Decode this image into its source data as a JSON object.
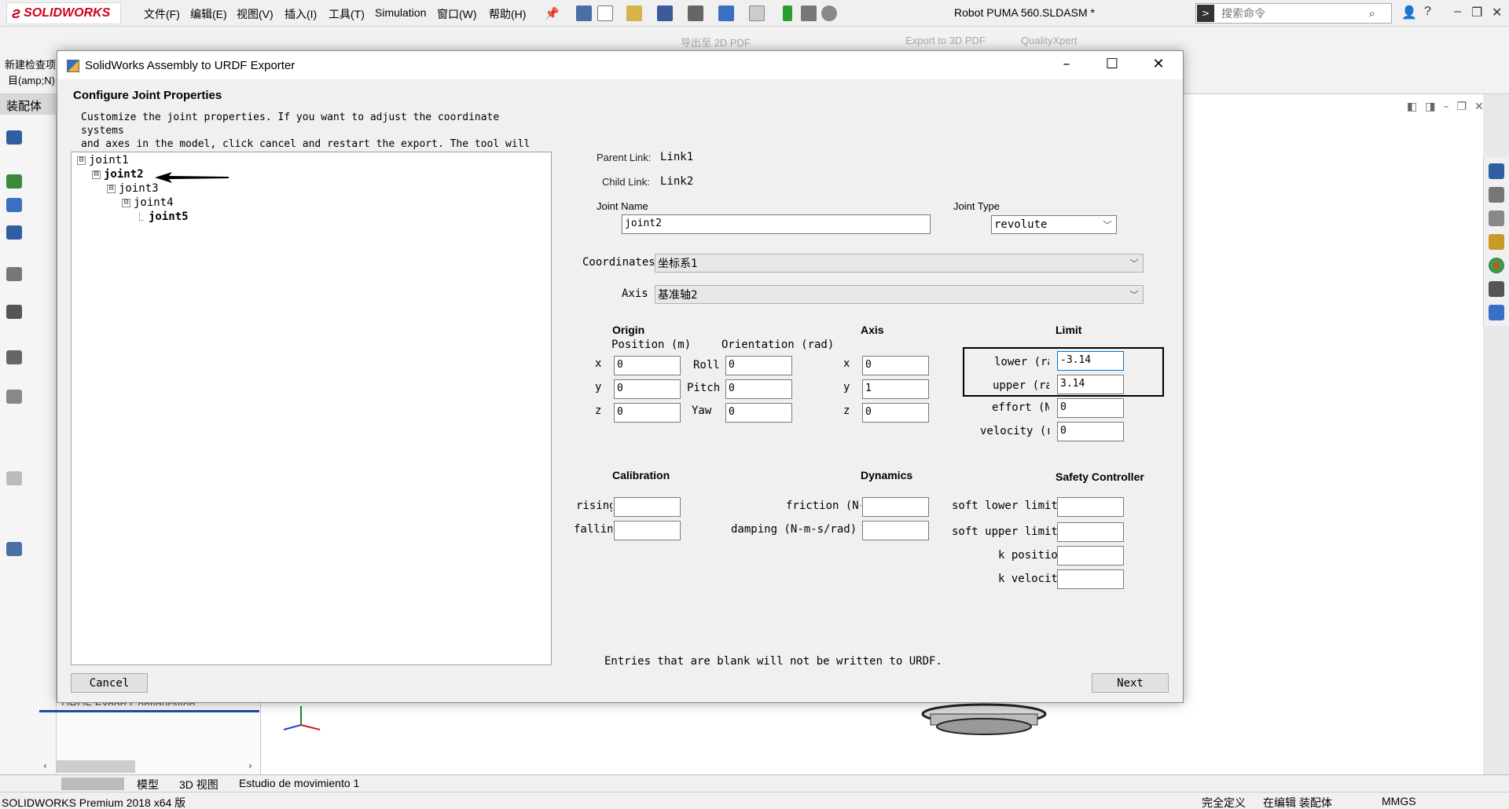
{
  "sw": {
    "logo_text": "SOLIDWORKS",
    "menu": [
      "文件(F)",
      "编辑(E)",
      "视图(V)",
      "插入(I)",
      "工具(T)",
      "Simulation",
      "窗口(W)",
      "帮助(H)"
    ],
    "document_title": "Robot PUMA 560.SLDASM *",
    "search_placeholder": "搜索命令",
    "ribbon_grey": [
      "导出至 2D PDF",
      "Export to 3D PDF",
      "QualityXpert"
    ],
    "left_labels": [
      "新建检查项",
      "目(amp;N)",
      "装配体"
    ],
    "bottom_tabs": [
      "模型",
      "3D 视图",
      "Estudio de movimiento 1"
    ],
    "fm_hidden_item": "URDF Export Configuration",
    "status_left": "SOLIDWORKS Premium 2018 x64 版",
    "status_right": [
      "完全定义",
      "在编辑 装配体",
      "MMGS"
    ]
  },
  "dialog": {
    "title": "SolidWorks Assembly to URDF Exporter",
    "heading": "Configure Joint Properties",
    "description": "Customize the joint properties. If you want to adjust the coordinate systems\nand axes in the model, click cancel and restart the export. The tool will\nrecognize your changes on the next run.",
    "tree": [
      {
        "label": "joint1",
        "depth": 0,
        "expander": "⊟",
        "bold": false
      },
      {
        "label": "joint2",
        "depth": 1,
        "expander": "⊟",
        "bold": true
      },
      {
        "label": "joint3",
        "depth": 2,
        "expander": "⊟",
        "bold": false
      },
      {
        "label": "joint4",
        "depth": 3,
        "expander": "⊟",
        "bold": false
      },
      {
        "label": "joint5",
        "depth": 4,
        "expander": "",
        "bold": true
      }
    ],
    "parent_link_label": "Parent Link:",
    "parent_link_value": "Link1",
    "child_link_label": "Child Link:",
    "child_link_value": "Link2",
    "joint_name_label": "Joint Name",
    "joint_name_value": "joint2",
    "joint_type_label": "Joint Type",
    "joint_type_value": "revolute",
    "coordinates_label": "Coordinates",
    "coordinates_value": "坐标系1",
    "axis_label": "Axis",
    "axis_value": "基准轴2",
    "origin": {
      "title": "Origin",
      "position_label": "Position (m)",
      "orientation_label": "Orientation (rad)",
      "x_label": "x",
      "y_label": "y",
      "z_label": "z",
      "x": "0",
      "y": "0",
      "z": "0",
      "roll_label": "Roll",
      "pitch_label": "Pitch",
      "yaw_label": "Yaw",
      "roll": "0",
      "pitch": "0",
      "yaw": "0"
    },
    "axis_section": {
      "title": "Axis",
      "x_label": "x",
      "y_label": "y",
      "z_label": "z",
      "x": "0",
      "y": "1",
      "z": "0"
    },
    "limit": {
      "title": "Limit",
      "lower_label": "lower (rad)",
      "lower": "-3.14",
      "upper_label": "upper (rad)",
      "upper": "3.14",
      "effort_label": "effort (N-m)",
      "effort": "0",
      "velocity_label": "velocity (rad/s)",
      "velocity": "0"
    },
    "calibration": {
      "title": "Calibration",
      "rising_label": "rising",
      "rising": "",
      "falling_label": "falling",
      "falling": ""
    },
    "dynamics": {
      "title": "Dynamics",
      "friction_label": "friction (N-m)",
      "friction": "",
      "damping_label": "damping (N-m-s/rad)",
      "damping": ""
    },
    "safety": {
      "title": "Safety Controller",
      "soft_lower_label": "soft lower limit",
      "soft_lower": "",
      "soft_upper_label": "soft upper limit",
      "soft_upper": "",
      "k_position_label": "k position",
      "k_position": "",
      "k_velocity_label": "k velocity",
      "k_velocity": ""
    },
    "footer_note": "Entries that are blank will not be written to URDF.",
    "cancel_label": "Cancel",
    "next_label": "Next"
  }
}
